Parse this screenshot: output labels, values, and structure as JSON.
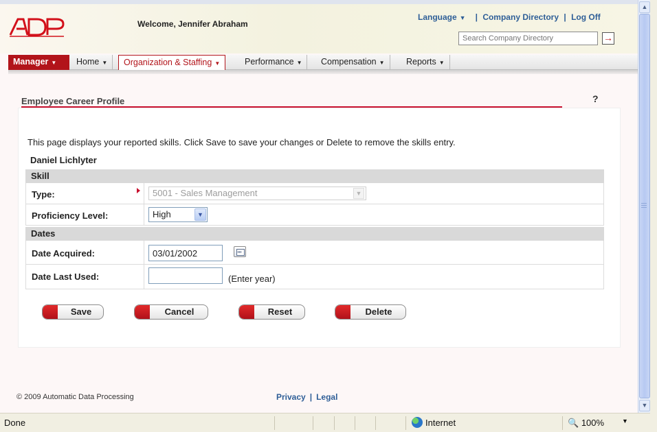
{
  "header": {
    "logo_alt": "ADP",
    "welcome": "Welcome, Jennifer Abraham",
    "language_label": "Language",
    "company_directory_label": "Company Directory",
    "log_off_label": "Log Off",
    "search_placeholder": "Search Company Directory"
  },
  "nav": {
    "tabs": [
      {
        "label": "Manager"
      },
      {
        "label": "Home"
      },
      {
        "label": "Organization & Staffing"
      },
      {
        "label": "Performance"
      },
      {
        "label": "Compensation"
      },
      {
        "label": "Reports"
      }
    ],
    "active_tab": "Organization & Staffing"
  },
  "section": {
    "title": "Employee Career Profile",
    "help": "?",
    "intro": "This page displays your reported skills. Click Save to save your changes or Delete to remove the skills entry.",
    "employee_name": "Daniel Lichlyter"
  },
  "form": {
    "skill_header": "Skill",
    "type_label": "Type:",
    "type_value": "5001 - Sales Management",
    "proficiency_label": "Proficiency Level:",
    "proficiency_value": "High",
    "dates_header": "Dates",
    "date_acquired_label": "Date Acquired:",
    "date_acquired_value": "03/01/2002",
    "date_last_used_label": "Date Last Used:",
    "date_last_used_value": "",
    "date_last_used_hint": "(Enter year)"
  },
  "actions": {
    "save": "Save",
    "cancel": "Cancel",
    "reset": "Reset",
    "delete": "Delete"
  },
  "footer": {
    "copyright": "© 2009 Automatic Data Processing",
    "privacy": "Privacy",
    "legal": "Legal"
  },
  "statusbar": {
    "status": "Done",
    "zone": "Internet",
    "zoom": "100%"
  },
  "colors": {
    "brand_red": "#c8102e",
    "link_blue": "#2e5e97",
    "manager_tab": "#b2141a"
  }
}
